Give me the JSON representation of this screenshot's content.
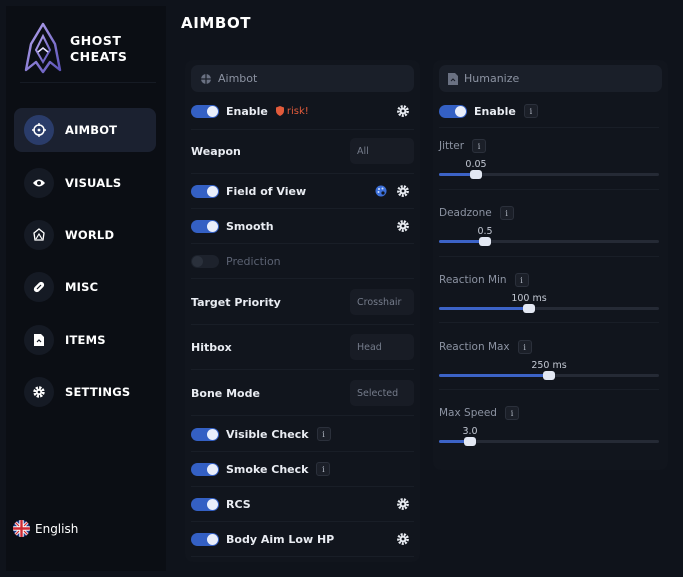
{
  "brand": {
    "line1": "GHOST",
    "line2": "CHEATS"
  },
  "nav": [
    {
      "label": "AIMBOT",
      "icon": "crosshair-icon",
      "active": true
    },
    {
      "label": "VISUALS",
      "icon": "eye-icon",
      "active": false
    },
    {
      "label": "WORLD",
      "icon": "globe-icon",
      "active": false
    },
    {
      "label": "MISC",
      "icon": "pill-icon",
      "active": false
    },
    {
      "label": "ITEMS",
      "icon": "file-icon",
      "active": false
    },
    {
      "label": "SETTINGS",
      "icon": "gear-icon",
      "active": false
    }
  ],
  "language": {
    "label": "English",
    "icon": "uk-flag-icon"
  },
  "page_title": "AIMBOT",
  "aimbot_panel": {
    "title": "Aimbot",
    "enable": {
      "label": "Enable",
      "on": true,
      "risk_label": "risk!"
    },
    "weapon": {
      "label": "Weapon",
      "value": "All"
    },
    "field_of_view": {
      "label": "Field of View",
      "on": true
    },
    "smooth": {
      "label": "Smooth",
      "on": true
    },
    "prediction": {
      "label": "Prediction",
      "on": false
    },
    "target_priority": {
      "label": "Target Priority",
      "value": "Crosshair"
    },
    "hitbox": {
      "label": "Hitbox",
      "value": "Head"
    },
    "bone_mode": {
      "label": "Bone Mode",
      "value": "Selected"
    },
    "visible_check": {
      "label": "Visible Check",
      "on": true,
      "info": "i"
    },
    "smoke_check": {
      "label": "Smoke Check",
      "on": true,
      "info": "i"
    },
    "rcs": {
      "label": "RCS",
      "on": true
    },
    "body_aim": {
      "label": "Body Aim Low HP",
      "on": true
    }
  },
  "humanize_panel": {
    "title": "Humanize",
    "enable": {
      "label": "Enable",
      "on": true,
      "info": "i"
    },
    "sliders": [
      {
        "label": "Jitter",
        "info": "i",
        "value_text": "0.05",
        "fraction": 0.17
      },
      {
        "label": "Deadzone",
        "info": "i",
        "value_text": "0.5",
        "fraction": 0.21
      },
      {
        "label": "Reaction Min",
        "info": "i",
        "value_text": "100 ms",
        "fraction": 0.41
      },
      {
        "label": "Reaction Max",
        "info": "i",
        "value_text": "250 ms",
        "fraction": 0.5
      },
      {
        "label": "Max Speed",
        "info": "i",
        "value_text": "3.0",
        "fraction": 0.14
      }
    ]
  },
  "colors": {
    "accent": "#3c63c7",
    "risk": "#e25b3b",
    "background": "#0f131b"
  }
}
